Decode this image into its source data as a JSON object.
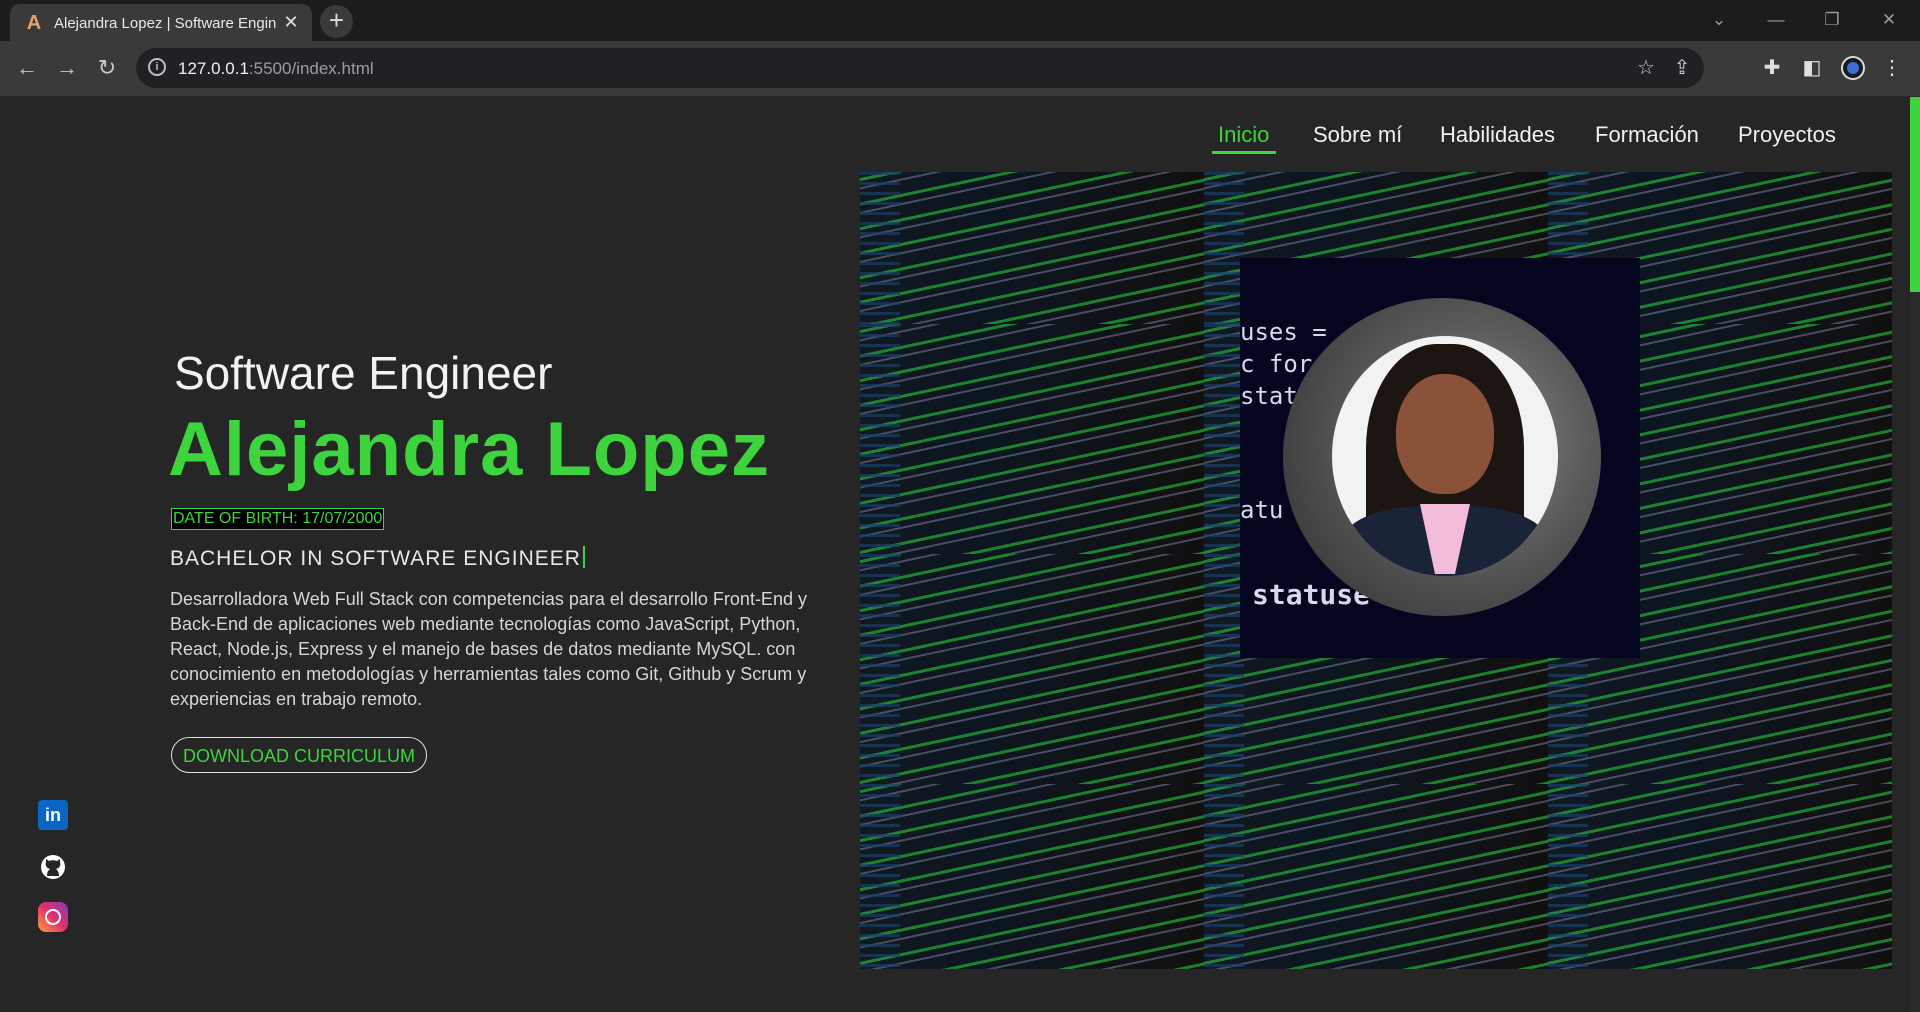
{
  "browser": {
    "tab_title": "Alejandra Lopez | Software Engineer",
    "tab_favicon": "A",
    "url_host": "127.0.0.1",
    "url_path": ":5500/index.html"
  },
  "nav": {
    "items": [
      "Inicio",
      "Sobre mí",
      "Habilidades",
      "Formación",
      "Proyectos"
    ],
    "active": "Inicio"
  },
  "hero": {
    "subtitle": "Software Engineer",
    "name": "Alejandra Lopez",
    "dob": "DATE OF BIRTH: 17/07/2000",
    "degree": "BACHELOR IN SOFTWARE ENGINEER",
    "description": "Desarrolladora Web Full Stack con competencias para el desarrollo Front-End y Back-End de aplicaciones web mediante tecnologías como JavaScript, Python, React, Node.js, Express y el manejo de bases de datos mediante MySQL. con conocimiento en metodologías y herramientas tales como Git, Github y Scrum y experiencias en trabajo remoto.",
    "download_label": "DOWNLOAD CURRICULUM",
    "code_text": [
      "uses =",
      "c for",
      "stat",
      "atu",
      "statuse"
    ]
  },
  "social": [
    "linkedin-icon",
    "github-icon",
    "instagram-icon"
  ],
  "colors": {
    "accent": "#3ed43e",
    "background": "#262626"
  }
}
